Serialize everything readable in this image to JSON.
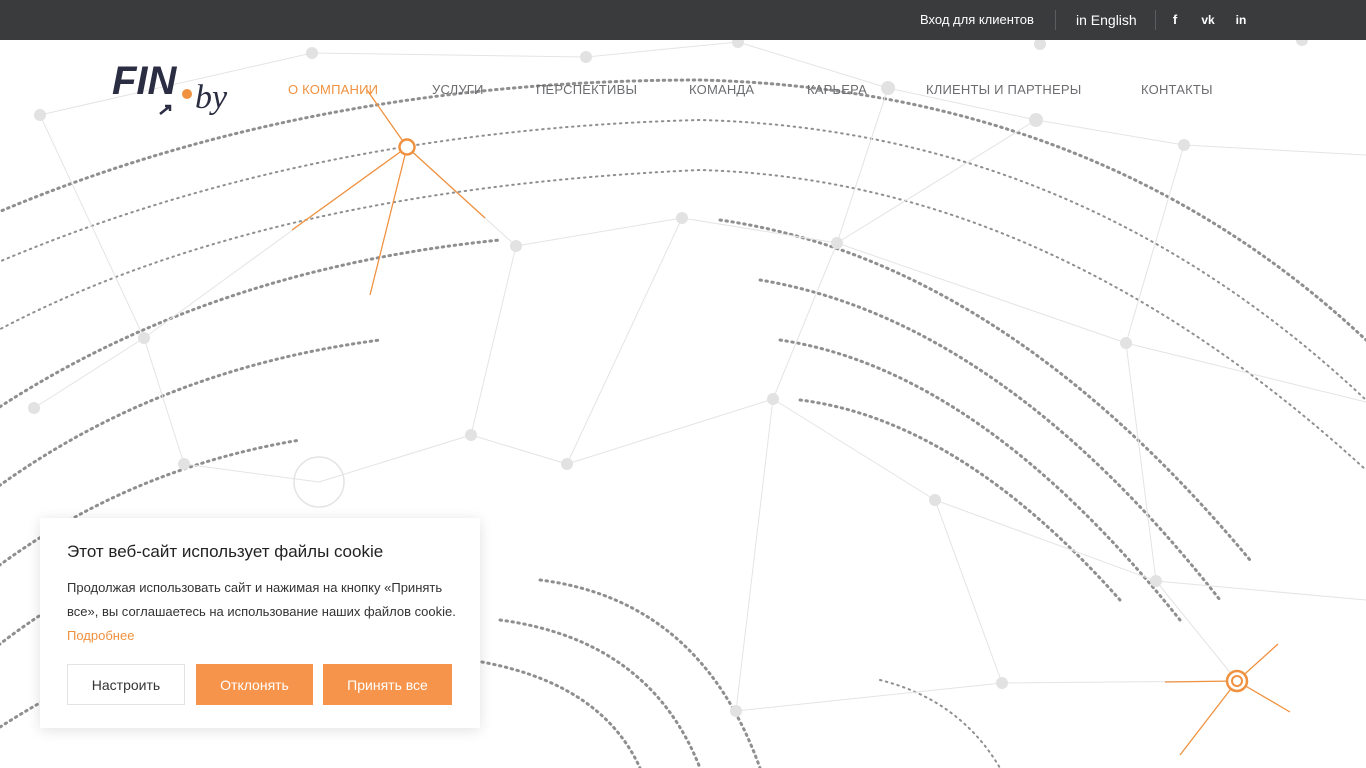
{
  "topbar": {
    "client_login": "Вход для клиентов",
    "language": "in English",
    "social": {
      "facebook": "f",
      "vk": "vk",
      "linkedin": "in"
    }
  },
  "logo": {
    "text_main": "FIN",
    "text_domain": "by"
  },
  "nav": {
    "items": [
      {
        "label": "О КОМПАНИИ",
        "active": true
      },
      {
        "label": "УСЛУГИ"
      },
      {
        "label": "ПЕРСПЕКТИВЫ"
      },
      {
        "label": "КОМАНДА"
      },
      {
        "label": "КАРЬЕРА"
      },
      {
        "label": "КЛИЕНТЫ И ПАРТНЕРЫ"
      },
      {
        "label": "КОНТАКТЫ"
      }
    ]
  },
  "cookie": {
    "title": "Этот веб-сайт использует файлы cookie",
    "text": "Продолжая использовать сайт и нажимая на кнопку «Принять все», вы соглашаетесь на использование наших файлов  cookie.",
    "more_link": "Подробнее",
    "configure_button": "Настроить",
    "reject_button": "Отклонять",
    "accept_button": "Принять все"
  },
  "colors": {
    "accent": "#f0913f",
    "topbar_bg": "#3a3b3d",
    "nav_text": "#6b6d70"
  }
}
